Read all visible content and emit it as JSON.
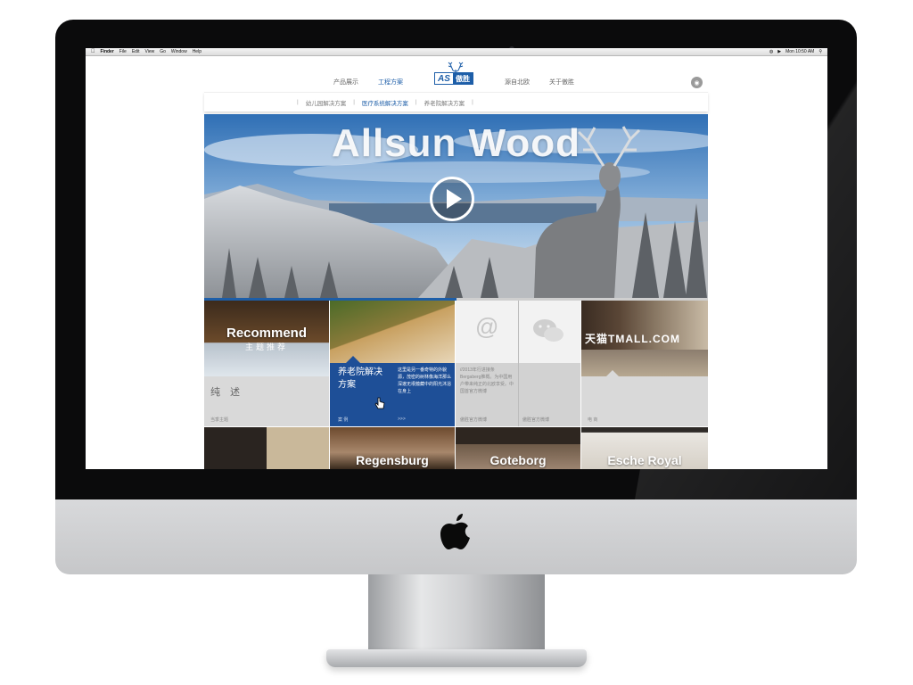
{
  "mac_menubar": {
    "app": "Finder",
    "menus": [
      "File",
      "Edit",
      "View",
      "Go",
      "Window",
      "Help"
    ],
    "clock": "Mon 10:50 AM"
  },
  "site": {
    "nav_left": [
      "产品展示",
      "工程方案"
    ],
    "nav_right": [
      "源自北欧",
      "关于傲胜"
    ],
    "active_nav": "工程方案",
    "logo": {
      "latin": "AS",
      "chinese": "傲胜"
    },
    "subnav": [
      "幼儿园解决方案",
      "医疗系统解决方案",
      "养老院解决方案"
    ],
    "active_subnav": "医疗系统解决方案"
  },
  "hero": {
    "title": "Allsun Wood"
  },
  "slider": {
    "progress": 0.5
  },
  "tiles": {
    "recommend": {
      "title": "Recommend",
      "subtitle": "主题推荐",
      "big_text": "纯 述",
      "caption": "当季主题"
    },
    "eldercare": {
      "title": "养老院解决方案",
      "description": "这里是另一番奇特的外貌源，茂密的树林像海洋那么深邃无垠蕴藏中的阳光沐浴在身上",
      "caption_left": "案 例",
      "caption_right": ">>>"
    },
    "social": {
      "description": "//2013年行进接条Bergaberg推概。为中国用户带来纯正的北欧享受。中国首官方微博",
      "caption_left": "傲胜官方微博",
      "caption_right": "傲胜官方微博"
    },
    "tmall": {
      "title": "天猫TMALL.COM",
      "caption": "电 商"
    }
  },
  "row2": [
    "",
    "Regensburg",
    "Goteborg",
    "Esche Royal"
  ],
  "colors": {
    "brand_blue": "#1d5ea8",
    "tile_blue": "#1e4f97"
  }
}
